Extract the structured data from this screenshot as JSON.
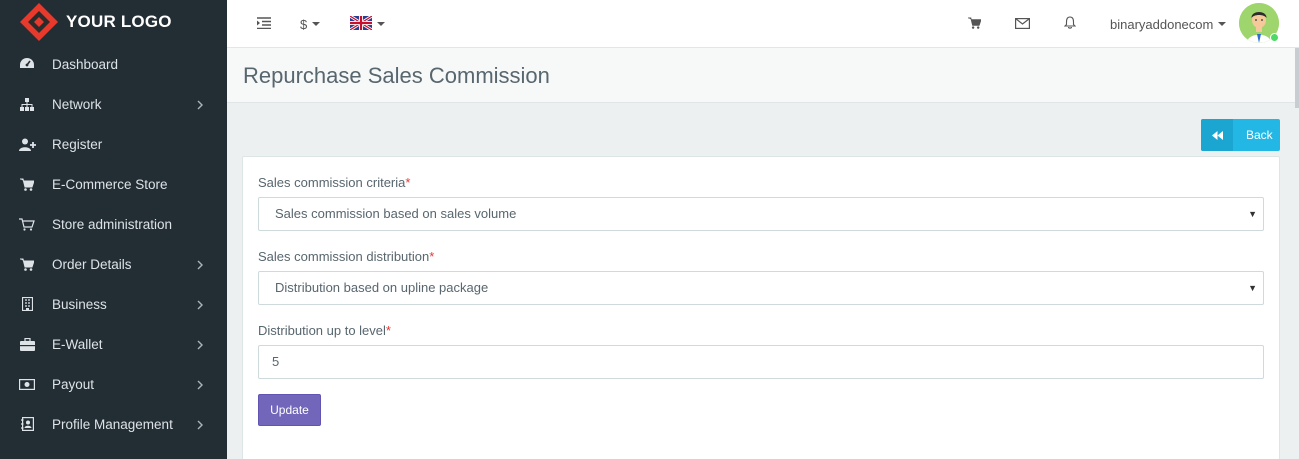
{
  "brand": {
    "name": "YOUR LOGO",
    "colors": {
      "logo_red": "#e8392d",
      "logo_dark": "#3b3b3b"
    }
  },
  "sidebar": {
    "items": [
      {
        "label": "Dashboard",
        "icon": "dashboard-icon",
        "has_submenu": false
      },
      {
        "label": "Network",
        "icon": "sitemap-icon",
        "has_submenu": true
      },
      {
        "label": "Register",
        "icon": "user-plus-icon",
        "has_submenu": false
      },
      {
        "label": "E-Commerce Store",
        "icon": "cart-icon",
        "has_submenu": false
      },
      {
        "label": "Store administration",
        "icon": "cart-outline-icon",
        "has_submenu": false
      },
      {
        "label": "Order Details",
        "icon": "cart-icon",
        "has_submenu": true
      },
      {
        "label": "Business",
        "icon": "building-icon",
        "has_submenu": true
      },
      {
        "label": "E-Wallet",
        "icon": "briefcase-icon",
        "has_submenu": true
      },
      {
        "label": "Payout",
        "icon": "money-icon",
        "has_submenu": true
      },
      {
        "label": "Profile Management",
        "icon": "address-book-icon",
        "has_submenu": true
      }
    ]
  },
  "topbar": {
    "currency": "$",
    "language": "flag-uk-icon",
    "username": "binaryaddonecom"
  },
  "page": {
    "title": "Repurchase Sales Commission",
    "back_label": "Back"
  },
  "form": {
    "criteria_label": "Sales commission criteria",
    "criteria_value": "Sales commission based on sales volume",
    "distribution_label": "Sales commission distribution",
    "distribution_value": "Distribution based on upline package",
    "level_label": "Distribution up to level",
    "level_value": "5",
    "required_mark": "*",
    "update_label": "Update"
  },
  "colors": {
    "sidebar_bg": "#232d34",
    "accent_info": "#23b7e5",
    "accent_primary": "#7266ba",
    "required": "#e53935"
  }
}
